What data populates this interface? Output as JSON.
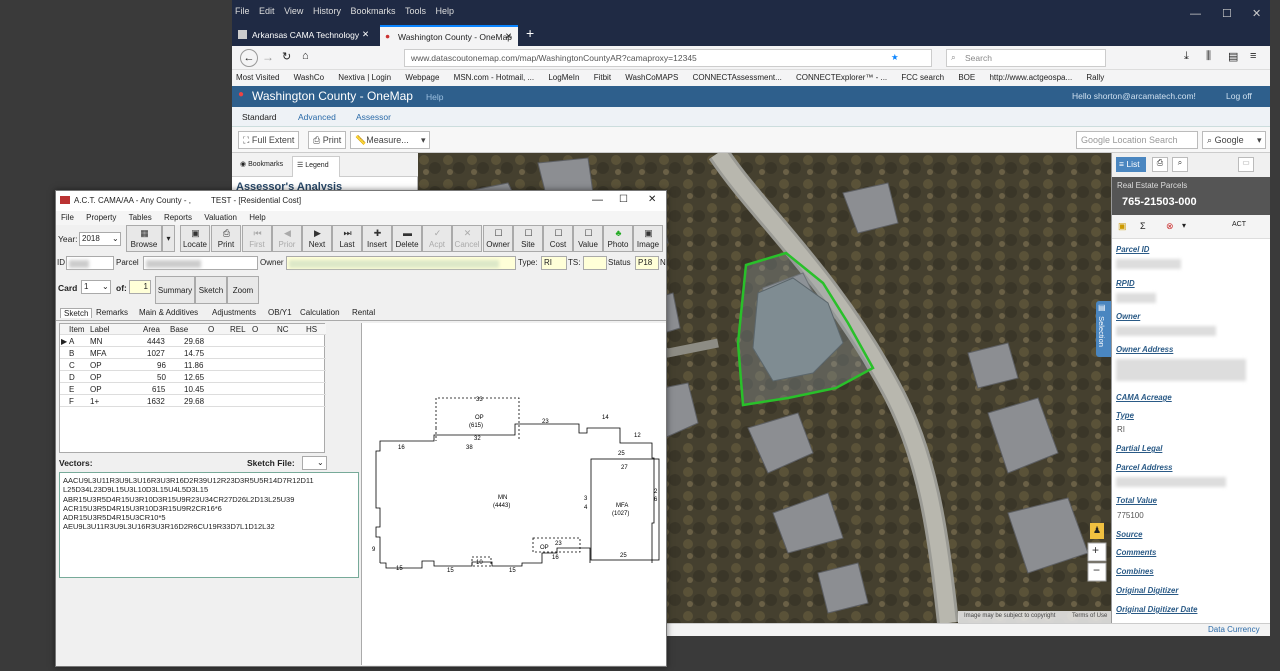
{
  "firefox": {
    "menu": [
      "File",
      "Edit",
      "View",
      "History",
      "Bookmarks",
      "Tools",
      "Help"
    ],
    "tabs": [
      {
        "label": "Arkansas CAMA Technology"
      },
      {
        "label": "Washington County - OneMap"
      }
    ],
    "url": "www.datascoutonemap.com/map/WashingtonCountyAR?camaproxy=12345",
    "search_placeholder": "Search",
    "bookmarks": [
      "Most Visited",
      "WashCo",
      "Nextiva | Login",
      "Webpage",
      "MSN.com - Hotmail, ...",
      "LogMeIn",
      "Fitbit",
      "WashCoMAPS",
      "CONNECTAssessment...",
      "CONNECTExplorer™ - ...",
      "FCC search",
      "BOE",
      "http://www.actgeospa...",
      "Rally"
    ]
  },
  "onemap": {
    "title": "Washington County - OneMap",
    "help": "Help",
    "user": "Hello shorton@arcamatech.com!",
    "logoff": "Log off",
    "tabs": [
      "Standard",
      "Advanced",
      "Assessor"
    ],
    "toolbar": {
      "full_extent": "Full Extent",
      "print": "Print",
      "measure": "Measure..."
    },
    "location_search_placeholder": "Google Location Search",
    "google": "Google",
    "left_tabs": {
      "bookmarks": "Bookmarks",
      "legend": "Legend"
    },
    "left_heading": "Assessor's Analysis",
    "map": {
      "attribution": "Image may be subject to copyright",
      "terms": "Terms of Use",
      "selection_tab": "Selection"
    },
    "panel": {
      "list": "List",
      "layer": "Real Estate Parcels",
      "parcel_number": "765-21503-000",
      "fields": [
        {
          "label": "Parcel ID",
          "value": ""
        },
        {
          "label": "RPID",
          "value": ""
        },
        {
          "label": "Owner",
          "value": ""
        },
        {
          "label": "Owner Address",
          "value": ""
        },
        {
          "label": "CAMA Acreage",
          "value": ""
        },
        {
          "label": "Type",
          "value": "RI"
        },
        {
          "label": "Partial Legal",
          "value": ""
        },
        {
          "label": "Parcel Address",
          "value": ""
        },
        {
          "label": "Total Value",
          "value": "775100"
        },
        {
          "label": "Source",
          "value": ""
        },
        {
          "label": "Comments",
          "value": ""
        },
        {
          "label": "Combines",
          "value": ""
        },
        {
          "label": "Original Digitizer",
          "value": ""
        },
        {
          "label": "Original Digitizer Date",
          "value": ""
        }
      ]
    },
    "footer": "Data Currency"
  },
  "cama": {
    "title": "A.C.T. CAMA/AA - Any County - ,",
    "subtitle": "TEST - [Residential Cost]",
    "menu": [
      "File",
      "Property",
      "Tables",
      "Reports",
      "Valuation",
      "Help"
    ],
    "year_label": "Year:",
    "year": "2018",
    "toolbar": [
      "Browse",
      "Locate",
      "Print",
      "First",
      "Prior",
      "Next",
      "Last",
      "Insert",
      "Delete",
      "Acpt",
      "Cancel",
      "Owner",
      "Site",
      "Cost",
      "Value",
      "Photo",
      "Image"
    ],
    "id_row": {
      "id": "ID",
      "parcel": "Parcel",
      "owner": "Owner",
      "type": "Type:",
      "type_val": "RI",
      "ts": "TS:",
      "status": "Status",
      "status_val": "P18",
      "n": "N"
    },
    "card_label": "Card",
    "card_val": "1",
    "of_label": "of:",
    "of_val": "1",
    "card_buttons": [
      "Summary",
      "Sketch",
      "Zoom"
    ],
    "subtabs": [
      "Sketch",
      "Remarks",
      "Main & Additives",
      "Adjustments",
      "OB/Y1",
      "Calculation",
      "Rental"
    ],
    "table": {
      "headers": [
        "Item",
        "Label",
        "Area",
        "Base",
        "O",
        "REL",
        "O",
        "NC",
        "HS"
      ],
      "rows": [
        [
          "A",
          "MN",
          "4443",
          "29.68"
        ],
        [
          "B",
          "MFA",
          "1027",
          "14.75"
        ],
        [
          "C",
          "OP",
          "96",
          "11.86"
        ],
        [
          "D",
          "OP",
          "50",
          "12.65"
        ],
        [
          "E",
          "OP",
          "615",
          "10.45"
        ],
        [
          "F",
          "1+",
          "1632",
          "29.68"
        ]
      ]
    },
    "vectors_label": "Vectors:",
    "sketch_file_label": "Sketch File:",
    "vectors": [
      "AACU9L3U11R3U9L3U16R3U3R16D2R39U12R23D3R5U5R14D7R12D11",
      "L25D34L23D9L15U3L10D3L15U4L5D3L15",
      "ABR15U3R5D4R15U3R10D3R15U9R23U34CR27D26L2D13L25U39",
      "ACR15U3R5D4R15U3R10D3R15U9R2CR16*6",
      "ADR15U3R5D4R15U3CR10*5",
      "AEU9L3U11R3U9L3U16R3U3R16D2R6CU19R33D7L1D12L32"
    ],
    "sketch": {
      "op_top": "OP\n(615)",
      "mn": "MN\n(4443)",
      "mfa": "MFA\n(1027)",
      "op_small": "OP",
      "labels": [
        "33",
        "32",
        "38",
        "23",
        "14",
        "12",
        "16",
        "27",
        "25",
        "3",
        "2",
        "6",
        "1",
        "23",
        "16",
        "6",
        "16",
        "15",
        "15",
        "15",
        "10",
        "5",
        "9",
        "4",
        "3",
        "9",
        "4"
      ]
    }
  }
}
